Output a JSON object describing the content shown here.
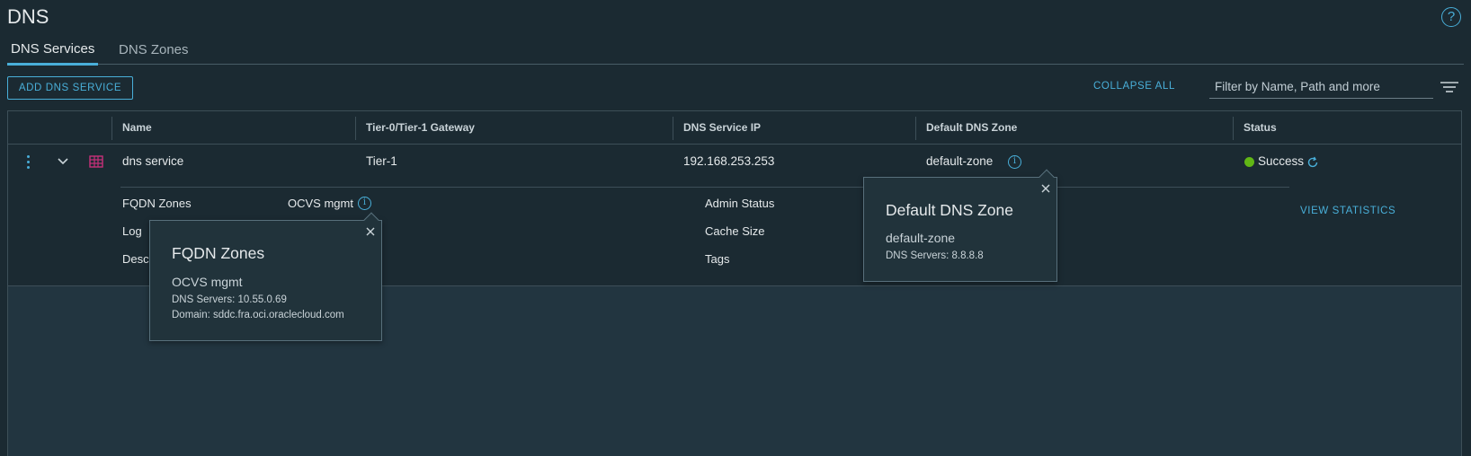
{
  "page": {
    "title": "DNS"
  },
  "tabs": [
    {
      "label": "DNS Services",
      "active": true
    },
    {
      "label": "DNS Zones",
      "active": false
    }
  ],
  "toolbar": {
    "add_label": "ADD DNS SERVICE",
    "collapse_label": "COLLAPSE ALL",
    "filter_placeholder": "Filter by Name, Path and more"
  },
  "grid": {
    "columns": [
      "Name",
      "Tier-0/Tier-1 Gateway",
      "DNS Service IP",
      "Default DNS Zone",
      "Status"
    ],
    "row": {
      "name": "dns service",
      "gateway": "Tier-1",
      "ip": "192.168.253.253",
      "default_zone": "default-zone",
      "status": "Success",
      "status_color": "#61b715"
    },
    "details": {
      "fqdn_label": "FQDN Zones",
      "fqdn_value": "OCVS mgmt",
      "log_label": "Log",
      "desc_label": "Desc",
      "admin_label": "Admin Status",
      "cache_label": "Cache Size",
      "tags_label": "Tags",
      "view_stats_label": "VIEW STATISTICS"
    }
  },
  "popover_fqdn": {
    "title": "FQDN Zones",
    "name": "OCVS mgmt",
    "servers": "DNS Servers: 10.55.0.69",
    "domain": "Domain: sddc.fra.oci.oraclecloud.com"
  },
  "popover_default": {
    "title": "Default DNS Zone",
    "name": "default-zone",
    "servers": "DNS Servers: 8.8.8.8"
  },
  "colors": {
    "accent": "#49afd9",
    "background": "#1b2a32"
  }
}
